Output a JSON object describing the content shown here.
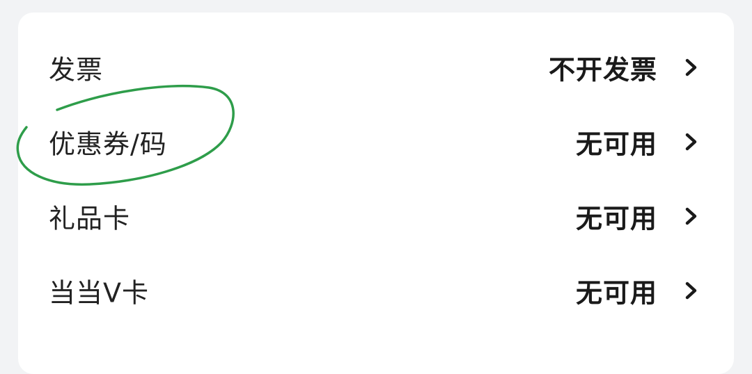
{
  "rows": [
    {
      "label": "发票",
      "value": "不开发票",
      "icon": "chevron-right-icon"
    },
    {
      "label": "优惠券/码",
      "value": "无可用",
      "icon": "chevron-right-icon"
    },
    {
      "label": "礼品卡",
      "value": "无可用",
      "icon": "chevron-right-icon"
    },
    {
      "label": "当当V卡",
      "value": "无可用",
      "icon": "chevron-right-icon"
    }
  ],
  "annotation": {
    "shape": "hand-drawn-ellipse",
    "color": "#2e9d4a",
    "target": "优惠券/码"
  }
}
